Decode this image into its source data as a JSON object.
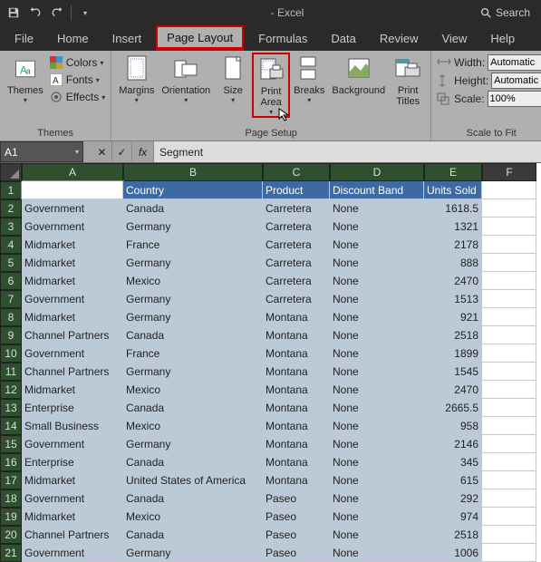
{
  "titlebar": {
    "title": "- Excel",
    "search_placeholder": "Search"
  },
  "tabs": [
    "File",
    "Home",
    "Insert",
    "Page Layout",
    "Formulas",
    "Data",
    "Review",
    "View",
    "Help"
  ],
  "active_tab": "Page Layout",
  "ribbon": {
    "themes": {
      "group_label": "Themes",
      "themes": "Themes",
      "colors": "Colors",
      "fonts": "Fonts",
      "effects": "Effects"
    },
    "pagesetup": {
      "group_label": "Page Setup",
      "margins": "Margins",
      "orientation": "Orientation",
      "size": "Size",
      "print_area": "Print\nArea",
      "breaks": "Breaks",
      "background": "Background",
      "print_titles": "Print\nTitles"
    },
    "scale": {
      "group_label": "Scale to Fit",
      "width": "Width:",
      "height": "Height:",
      "scale": "Scale:",
      "width_val": "Automatic",
      "height_val": "Automatic",
      "scale_val": "100%"
    }
  },
  "namebox": "A1",
  "formula": "Segment",
  "columns": [
    "A",
    "B",
    "C",
    "D",
    "E",
    "F"
  ],
  "headers": [
    "Segment",
    "Country",
    "Product",
    "Discount Band",
    "Units Sold"
  ],
  "rows": [
    [
      "Government",
      "Canada",
      "Carretera",
      "None",
      "1618.5"
    ],
    [
      "Government",
      "Germany",
      "Carretera",
      "None",
      "1321"
    ],
    [
      "Midmarket",
      "France",
      "Carretera",
      "None",
      "2178"
    ],
    [
      "Midmarket",
      "Germany",
      "Carretera",
      "None",
      "888"
    ],
    [
      "Midmarket",
      "Mexico",
      "Carretera",
      "None",
      "2470"
    ],
    [
      "Government",
      "Germany",
      "Carretera",
      "None",
      "1513"
    ],
    [
      "Midmarket",
      "Germany",
      "Montana",
      "None",
      "921"
    ],
    [
      "Channel Partners",
      "Canada",
      "Montana",
      "None",
      "2518"
    ],
    [
      "Government",
      "France",
      "Montana",
      "None",
      "1899"
    ],
    [
      "Channel Partners",
      "Germany",
      "Montana",
      "None",
      "1545"
    ],
    [
      "Midmarket",
      "Mexico",
      "Montana",
      "None",
      "2470"
    ],
    [
      "Enterprise",
      "Canada",
      "Montana",
      "None",
      "2665.5"
    ],
    [
      "Small Business",
      "Mexico",
      "Montana",
      "None",
      "958"
    ],
    [
      "Government",
      "Germany",
      "Montana",
      "None",
      "2146"
    ],
    [
      "Enterprise",
      "Canada",
      "Montana",
      "None",
      "345"
    ],
    [
      "Midmarket",
      "United States of America",
      "Montana",
      "None",
      "615"
    ],
    [
      "Government",
      "Canada",
      "Paseo",
      "None",
      "292"
    ],
    [
      "Midmarket",
      "Mexico",
      "Paseo",
      "None",
      "974"
    ],
    [
      "Channel Partners",
      "Canada",
      "Paseo",
      "None",
      "2518"
    ],
    [
      "Government",
      "Germany",
      "Paseo",
      "None",
      "1006"
    ]
  ]
}
